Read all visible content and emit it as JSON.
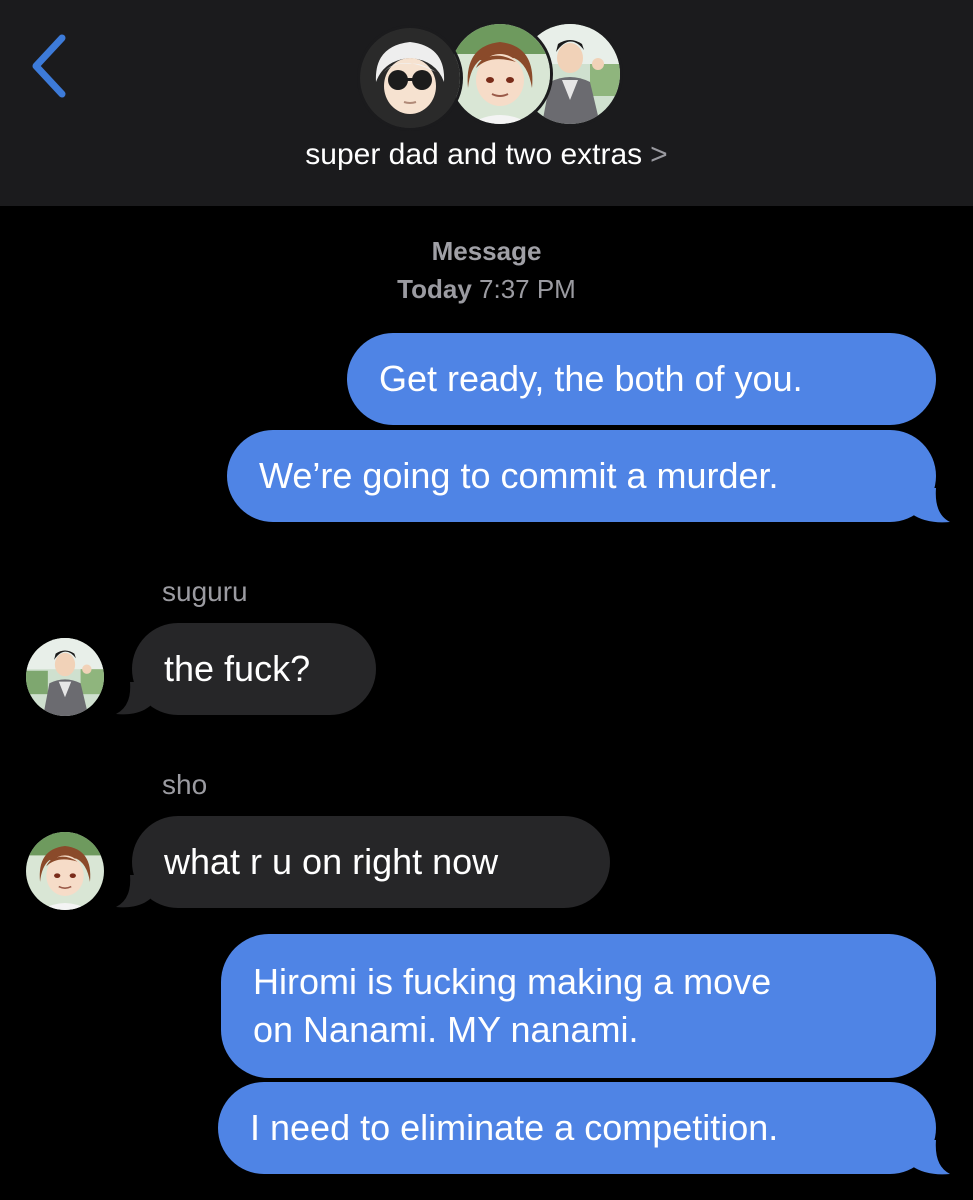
{
  "header": {
    "back_icon": "chevron-left-icon",
    "title": "super dad and two extras",
    "title_chevron": ">",
    "avatars": [
      "gojo-avatar",
      "sho-avatar",
      "suguru-avatar"
    ]
  },
  "meta": {
    "label": "Message",
    "day": "Today",
    "time": "7:37 PM"
  },
  "messages": [
    {
      "from": "me",
      "text": "Get ready, the both of you."
    },
    {
      "from": "me",
      "text": "We’re going to commit a murder."
    },
    {
      "from": "suguru",
      "sender": "suguru",
      "text": "the fuck?"
    },
    {
      "from": "sho",
      "sender": "sho",
      "text": "what r u on right now"
    },
    {
      "from": "me",
      "lines": [
        "Hiromi is fucking making a move",
        "on Nanami. MY nanami."
      ]
    },
    {
      "from": "me",
      "text": "I need to eliminate a competition."
    }
  ],
  "colors": {
    "header_bg": "#1b1b1d",
    "outgoing_bubble": "#4f84e5",
    "incoming_bubble": "#262628",
    "accent_blue": "#3d7bd9",
    "meta_gray": "#9b9ba1"
  }
}
